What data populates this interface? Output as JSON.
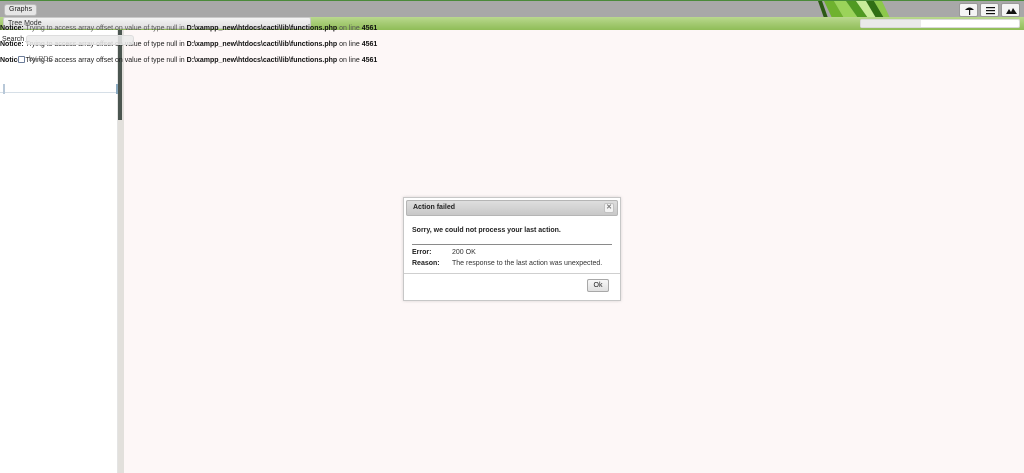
{
  "topbar": {
    "tab_label": "Graphs",
    "icons": [
      "tree-icon",
      "list-icon",
      "preview-icon"
    ]
  },
  "subbar": {
    "tree_mode_label": "Tree Mode"
  },
  "sidebar": {
    "search_label": "Search",
    "checkbox_label": "by RDC"
  },
  "notices": [
    {
      "prefix": "Notice:",
      "text": " Trying to access array offset on value of type null in ",
      "path": "D:\\xampp_new\\htdocs\\cacti\\lib\\functions.php",
      "suffix": " on line ",
      "line": "4561"
    },
    {
      "prefix": "Notice:",
      "text": " Trying to access array offset on value of type null in ",
      "path": "D:\\xampp_new\\htdocs\\cacti\\lib\\functions.php",
      "suffix": " on line ",
      "line": "4561"
    },
    {
      "prefix": "Notice:",
      "text": " Trying to access array offset on value of type null in ",
      "path": "D:\\xampp_new\\htdocs\\cacti\\lib\\functions.php",
      "suffix": " on line ",
      "line": "4561"
    }
  ],
  "dialog": {
    "title": "Action failed",
    "close_glyph": "✕",
    "message": "Sorry, we could not process your last action.",
    "error_label": "Error:",
    "error_value": "200 OK",
    "reason_label": "Reason:",
    "reason_value": "The response to the last action was unexpected.",
    "ok_label": "Ok"
  },
  "colors": {
    "accent_green": "#8fbd57",
    "topbar_gray": "#a8a8a8",
    "main_bg": "#fdf7f7"
  }
}
